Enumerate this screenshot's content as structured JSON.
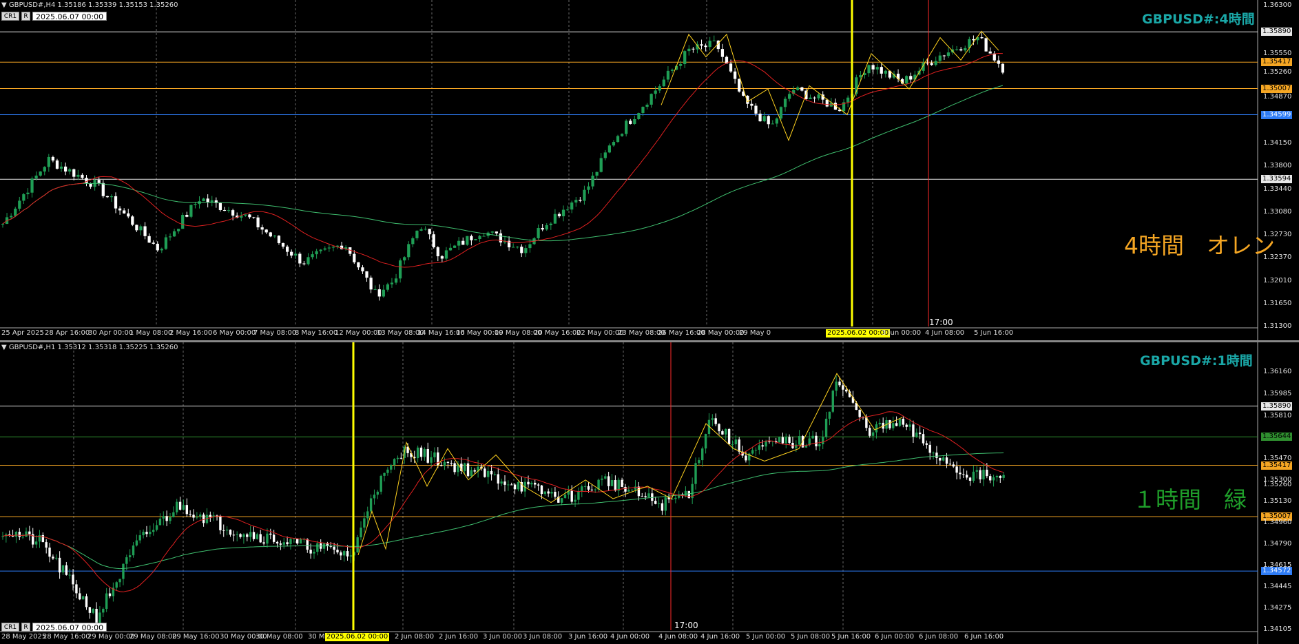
{
  "top": {
    "symbol_info": "GBPUSD#,H4  1.35186 1.35339 1.35153 1.35260",
    "buttons": [
      "CR1",
      "R"
    ],
    "date_box": "2025.06.07 00:00",
    "title": "GBPUSD#:4時間",
    "big_label": "4時間　オレン",
    "price_axis": [
      "1.36300",
      "1.35890",
      "1.35550",
      "1.35417",
      "1.35260",
      "1.35007",
      "1.34870",
      "1.34599",
      "1.34150",
      "1.33800",
      "1.33594",
      "1.33440",
      "1.33080",
      "1.32730",
      "1.32370",
      "1.32010",
      "1.31650",
      "1.31300"
    ],
    "time_axis": [
      "25 Apr 2025",
      "28 Apr 16:00",
      "30 Apr 00:00",
      "1 May 08:00",
      "2 May 16:00",
      "6 May 00:00",
      "7 May 08:00",
      "8 May 16:00",
      "12 May 00:00",
      "13 May 08:00",
      "14 May 16:00",
      "16 May 00:00",
      "19 May 08:00",
      "20 May 16:00",
      "22 May 00:00",
      "23 May 08:00",
      "26 May 16:00",
      "28 May 00:00",
      "29 May 0",
      "2025.06.02 00:00",
      "3 Jun 00:00",
      "4 Jun 08:00",
      "5 Jun 16:00"
    ],
    "time_marker": "17:00",
    "hlines": [
      {
        "price": "1.35890",
        "color": "#e8e8e8"
      },
      {
        "price": "1.35417",
        "color": "#f5a623"
      },
      {
        "price": "1.35007",
        "color": "#f5a623"
      },
      {
        "price": "1.34599",
        "color": "#2e7cf6"
      },
      {
        "price": "1.33594",
        "color": "#e8e8e8"
      }
    ],
    "price_range": [
      1.313,
      1.363
    ]
  },
  "bottom": {
    "symbol_info": "GBPUSD#,H1  1.35312 1.35318 1.35225 1.35260",
    "buttons": [
      "CR1",
      "R"
    ],
    "date_box": "2025.06.07 00:00",
    "title": "GBPUSD#:1時間",
    "big_label": "１時間　緑",
    "price_axis": [
      "1.36160",
      "1.35985",
      "1.35890",
      "1.35810",
      "1.35644",
      "1.35470",
      "1.35417",
      "1.35300",
      "1.35260",
      "1.35130",
      "1.35007",
      "1.34960",
      "1.34790",
      "1.34615",
      "1.34572",
      "1.34445",
      "1.34275",
      "1.34105"
    ],
    "time_axis": [
      "28 May 2025",
      "28 May 16:00",
      "29 May 00:00",
      "29 May 08:00",
      "29 May 16:00",
      "30 May 00:00",
      "30 May 08:00",
      "30 Ma",
      "2025.06.02 00:00",
      "2 Jun 08:00",
      "2 Jun 16:00",
      "3 Jun 00:00",
      "3 Jun 08:00",
      "3 Jun 16:00",
      "4 Jun 00:00",
      "4 Jun 08:00",
      "4 Jun 16:00",
      "5 Jun 00:00",
      "5 Jun 08:00",
      "5 Jun 16:00",
      "6 Jun 00:00",
      "6 Jun 08:00",
      "6 Jun 16:00"
    ],
    "time_marker": "17:00",
    "hlines": [
      {
        "price": "1.35890",
        "color": "#e8e8e8"
      },
      {
        "price": "1.35644",
        "color": "#2f8f2f"
      },
      {
        "price": "1.35417",
        "color": "#f5a623"
      },
      {
        "price": "1.35007",
        "color": "#f5a623"
      },
      {
        "price": "1.34572",
        "color": "#2e7cf6"
      }
    ],
    "price_range": [
      1.341,
      1.363
    ]
  },
  "colors": {
    "bull": "#1f9e55",
    "bear": "#ffffff",
    "ma_fast": "#e02020",
    "ma_slow": "#3fbf6f",
    "zigzag": "#ffd21f",
    "vline_yellow": "#ffff00",
    "vline_red": "#ff2a2a",
    "grid": "#6a6a6a",
    "title": "#1aa7a7",
    "top_big_label": "#f5a623",
    "bottom_big_label": "#1f9e2a"
  }
}
